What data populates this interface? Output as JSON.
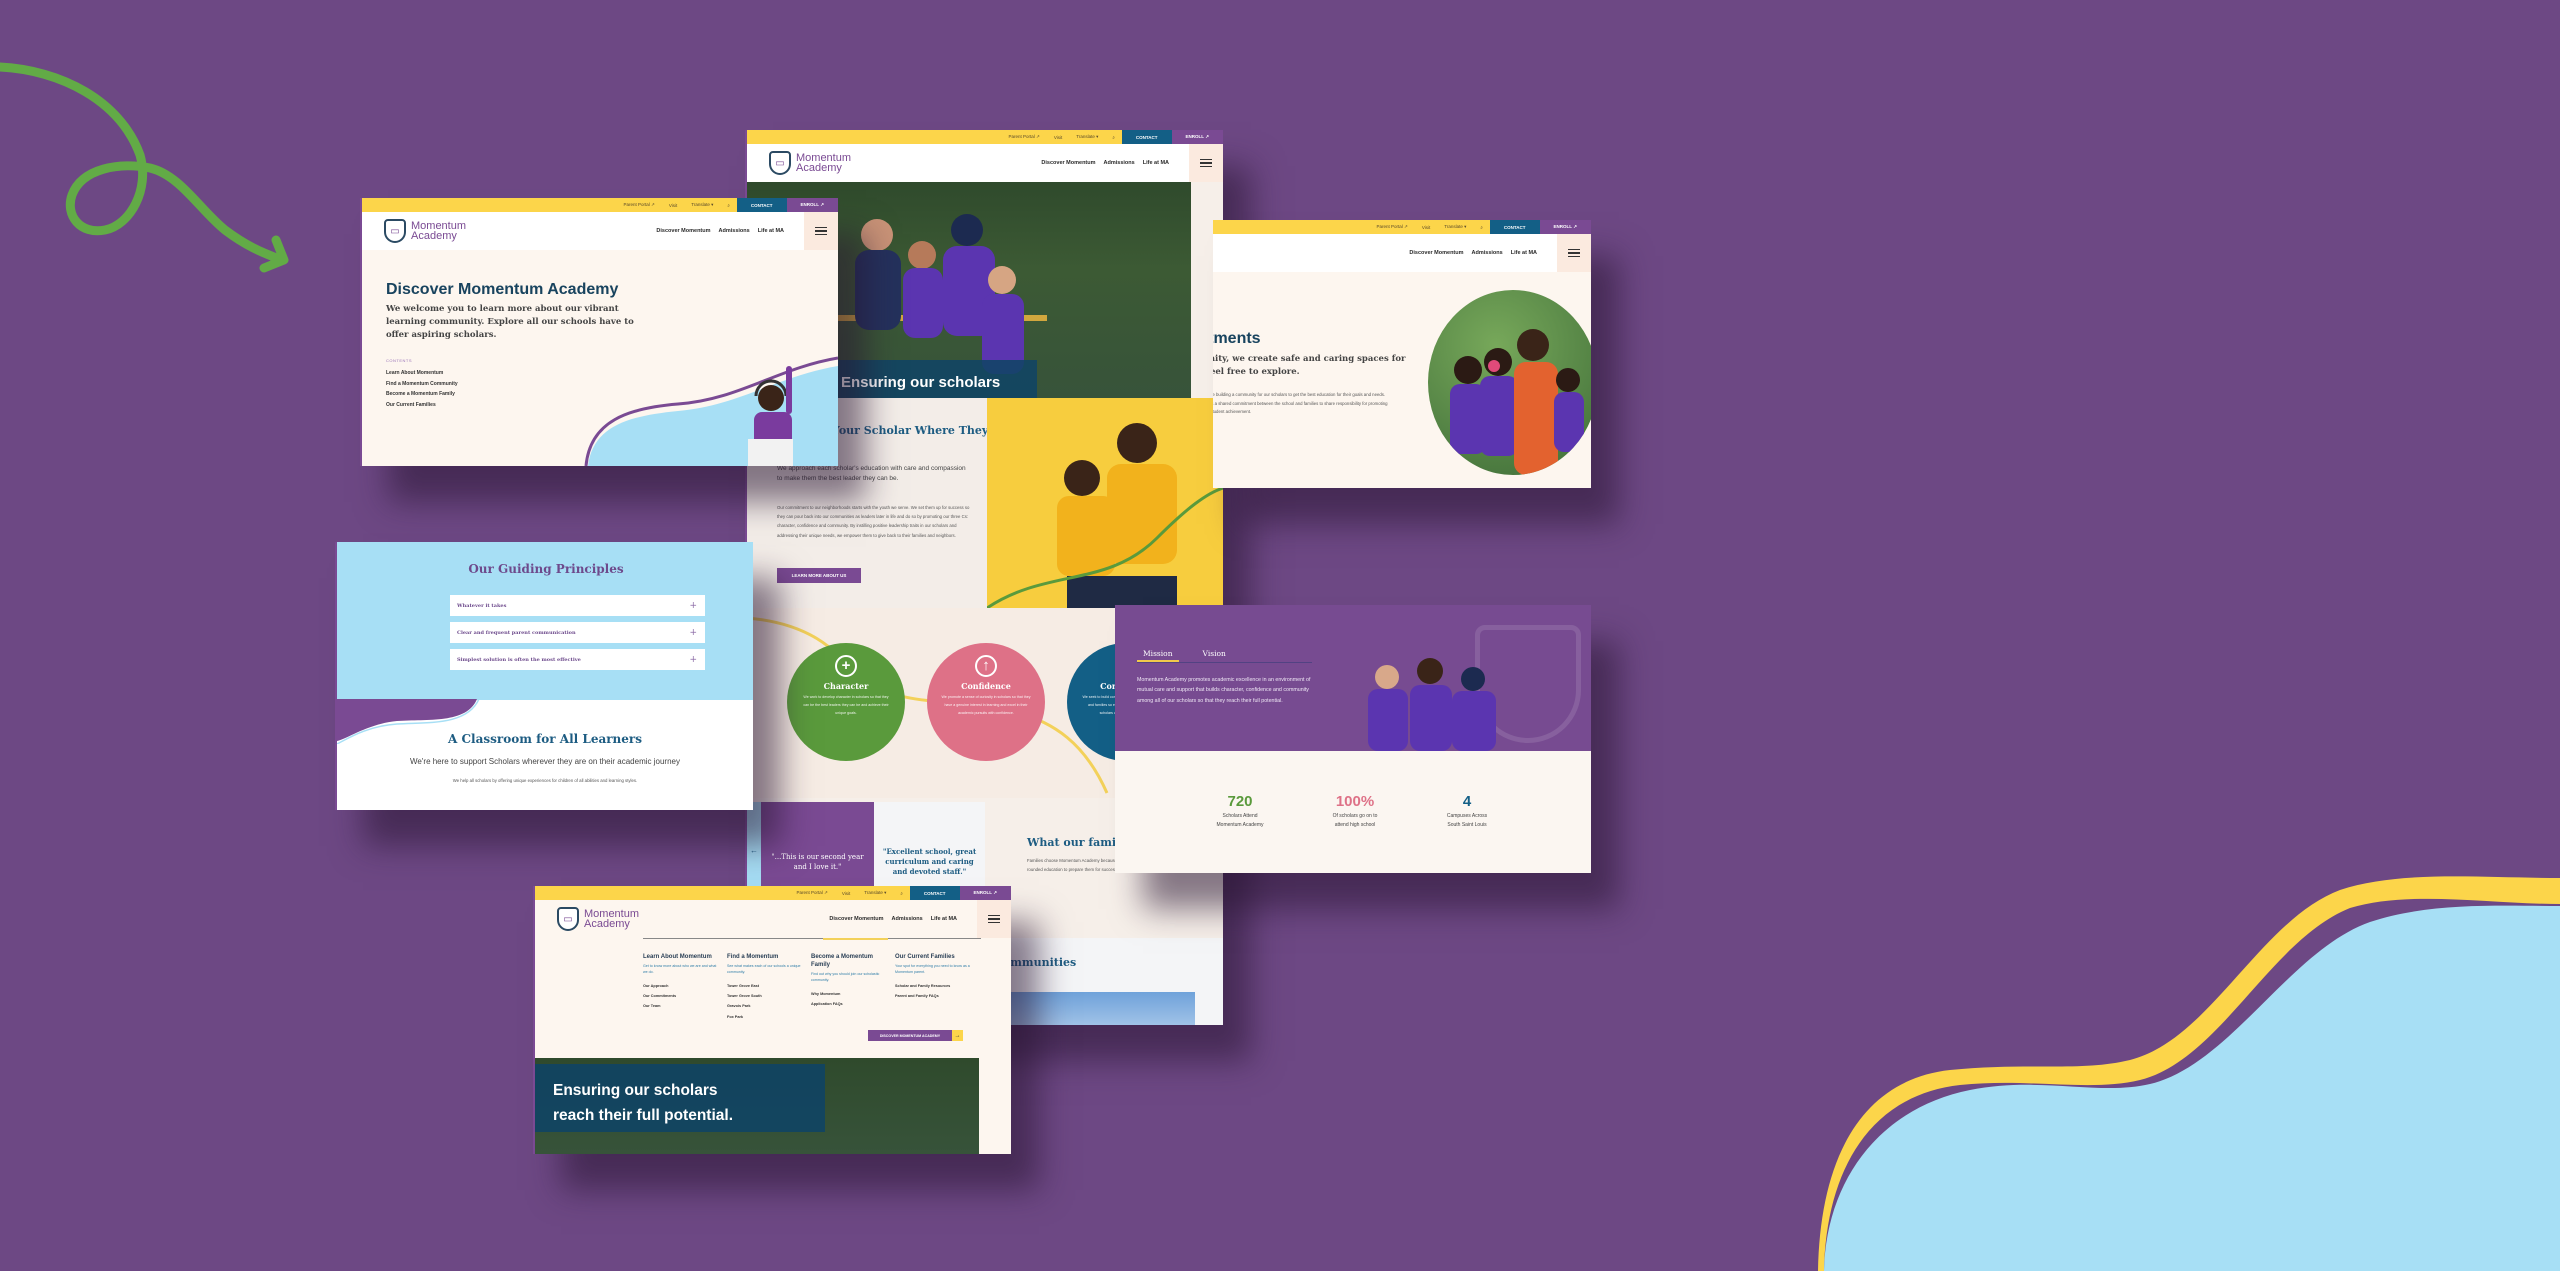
{
  "brand": {
    "name_line1": "Momentum",
    "name_line2": "Academy",
    "colors": {
      "background_purple": "#6d4884",
      "brand_purple": "#7a4a93",
      "yellow": "#fcd54a",
      "teal_blue": "#135f86",
      "navy": "#18435e",
      "sky_blue": "#a7dff5",
      "green": "#5a9a3c",
      "pink": "#de7187",
      "cream": "#fdf6ef"
    }
  },
  "utility_bar": {
    "parent_portal": "Parent Portal ↗",
    "visit": "Visit",
    "translate": "Translate ▾",
    "search_icon": "⌕",
    "contact": "CONTACT",
    "enroll": "ENROLL ↗"
  },
  "main_nav": {
    "items": [
      "Discover Momentum",
      "Admissions",
      "Life at MA"
    ]
  },
  "discover_page": {
    "title": "Discover Momentum Academy",
    "lead": "We welcome you to learn more about our vibrant learning community. Explore all our schools have to offer aspiring scholars.",
    "contents_label": "CONTENTS",
    "toc": [
      "Learn About Momentum",
      "Find a Momentum Community",
      "Become a Momentum Family",
      "Our Current Families"
    ]
  },
  "home_page": {
    "hero_tagline_line1": "Ensuring our scholars",
    "hero_tagline_line2": "reach their full potential.",
    "approach_heading": "Meeting Your Scholar Where They Are",
    "approach_lead": "We approach each scholar's education with care and compassion to make them the best leader they can be.",
    "approach_body": "Our commitment to our neighborhoods starts with the youth we serve. We set them up for success so they can pour back into our communities as leaders later in life and do so by promoting our three Cs: character, confidence and community. By instilling positive leadership traits in our scholars and addressing their unique needs, we empower them to give back to their families and neighbors.",
    "learn_more_button": "LEARN MORE ABOUT US",
    "three_cs": [
      {
        "icon": "plus-circle-icon",
        "glyph": "+",
        "title": "Character",
        "text": "We work to develop character in scholars so that they can be the best leaders they can be and achieve their unique goals.",
        "color": "#5a9a3c"
      },
      {
        "icon": "arrow-up-circle-icon",
        "glyph": "↑",
        "title": "Confidence",
        "text": "We promote a sense of curiosity in scholars so that they have a genuine interest in learning and excel in their academic pursuits with confidence.",
        "color": "#de7187"
      },
      {
        "icon": "community-icon",
        "glyph": "○",
        "title": "Community",
        "text": "We seek to build community among scholars, teachers and families so everyone has a place where our scholars can thrive in community.",
        "color": "#135f86"
      }
    ],
    "testimonials": [
      "\"...This is our second year and I love it.\"",
      "\"Excellent school, great curriculum and caring and devoted staff.\""
    ],
    "testimonial_prev_arrow": "←",
    "families_heading": "What our families say",
    "families_body": "Families choose Momentum Academy because they know their children will receive a well-rounded education to prepare them for success in life, no matter what they choose to do.",
    "communities_heading": "Our Communities"
  },
  "commitments_page": {
    "title": "Our Commitments",
    "lead": "As a community, we create safe and caring spaces for scholars to feel free to explore.",
    "body": "We are building a community for our scholars to get the best education for their goals and needs. This is a shared commitment between the school and families to share responsibility for promoting high student achievement."
  },
  "principles_page": {
    "title": "Our Guiding Principles",
    "principles": [
      "Whatever it takes",
      "Clear and frequent parent communication",
      "Simplest solution is often the most effective"
    ],
    "classroom_title": "A Classroom for All Learners",
    "classroom_sub": "We're here to support Scholars wherever they are on their academic journey",
    "classroom_small": "We help all scholars by offering unique experiences for children of all abilities and learning styles."
  },
  "mission_page": {
    "tabs": [
      "Mission",
      "Vision"
    ],
    "active_tab": "Mission",
    "mission_text": "Momentum Academy promotes academic excellence in an environment of mutual care and support that builds character, confidence and community among all of our scholars so that they reach their full potential.",
    "stats": [
      {
        "value": "720",
        "label_line1": "Scholars Attend",
        "label_line2": "Momentum Academy",
        "color": "#5a9a3c"
      },
      {
        "value": "100%",
        "label_line1": "Of scholars go on to",
        "label_line2": "attend high school",
        "color": "#de7187"
      },
      {
        "value": "4",
        "label_line1": "Campuses Across",
        "label_line2": "South Saint Louis",
        "color": "#135f86"
      }
    ]
  },
  "mega_menu": {
    "columns": [
      {
        "heading": "Learn About Momentum",
        "desc": "Get to know more about who we are and what we do.",
        "links": [
          "Our Approach",
          "Our Commitments",
          "Our Team"
        ]
      },
      {
        "heading": "Find a Momentum",
        "desc": "See what makes each of our schools a unique community.",
        "links": [
          "Tower Grove East",
          "Tower Grove South",
          "Gravois Park",
          "Fox Park"
        ]
      },
      {
        "heading": "Become a Momentum Family",
        "desc": "Find out why you should join our scholastic community.",
        "links": [
          "Why Momentum",
          "Application FAQs"
        ]
      },
      {
        "heading": "Our Current Families",
        "desc": "Your spot for everything you need to know as a Momentum parent.",
        "links": [
          "Scholar and Family Resources",
          "Parent and Family FAQs"
        ]
      }
    ],
    "cta": "DISCOVER MOMENTUM ACADEMY",
    "cta_arrow": "→"
  }
}
